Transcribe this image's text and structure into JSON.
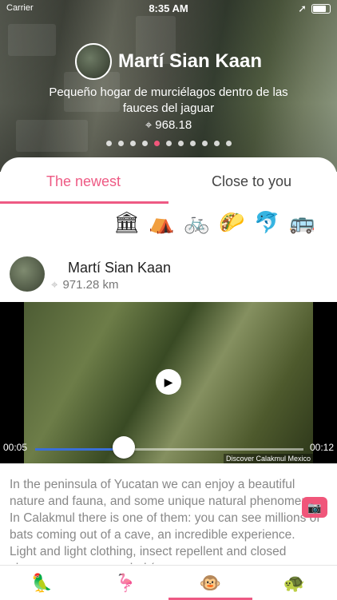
{
  "status": {
    "carrier": "Carrier",
    "time": "8:35 AM"
  },
  "hero": {
    "name": "Martí Sian Kaan",
    "description": "Pequeño hogar de murciélagos dentro de las fauces del jaguar",
    "distance": "968.18",
    "page_count": 11,
    "active_page": 5
  },
  "tabs": {
    "newest": "The newest",
    "close": "Close to you"
  },
  "categories": [
    "pyramid",
    "tent",
    "bicycle",
    "taco",
    "dolphin",
    "bus"
  ],
  "post": {
    "name": "Martí Sian Kaan",
    "distance": "971.28 km",
    "video": {
      "elapsed": "00:05",
      "total": "00:12",
      "progress": 0.33,
      "watermark": "Discover Calakmul Mexico"
    },
    "description": "In the peninsula of Yucatan we can enjoy a beautiful nature and fauna, and some unique natural phenomena. In Calakmul there is one of them: you can see millions of bats coming out of a cave, an incredible experience. Light and light clothing, insect repellent and closed shoes are recommended (you"
  },
  "bottom_nav": [
    "parrot",
    "flamingo",
    "monkey",
    "turtle"
  ],
  "colors": {
    "accent": "#ee5a84",
    "progress": "#3a6fd8"
  }
}
